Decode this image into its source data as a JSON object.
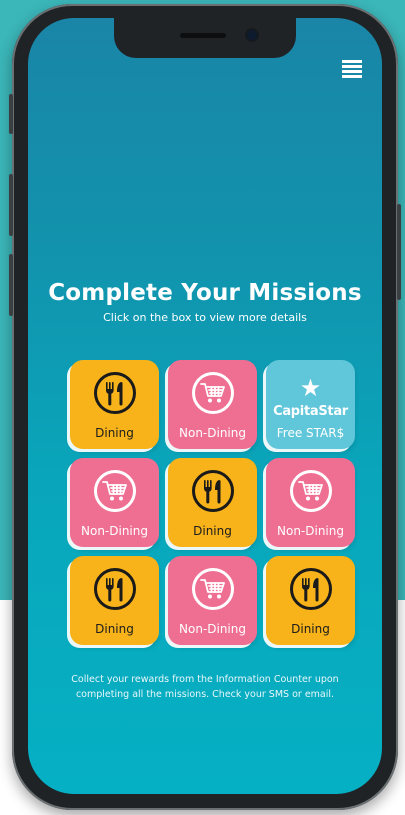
{
  "header": {
    "title": "Complete Your Missions",
    "subtitle": "Click on the box to view more details"
  },
  "menu": {
    "icon": "hamburger-menu-icon"
  },
  "missions": [
    {
      "type": "dining",
      "label": "Dining",
      "icon": "fork-knife-icon"
    },
    {
      "type": "non-dining",
      "label": "Non-Dining",
      "icon": "shopping-cart-icon"
    },
    {
      "type": "capitastar",
      "brand": "CapitaStar",
      "label": "Free STAR$",
      "icon": "star-icon"
    },
    {
      "type": "non-dining",
      "label": "Non-Dining",
      "icon": "shopping-cart-icon"
    },
    {
      "type": "dining",
      "label": "Dining",
      "icon": "fork-knife-icon"
    },
    {
      "type": "non-dining",
      "label": "Non-Dining",
      "icon": "shopping-cart-icon"
    },
    {
      "type": "dining",
      "label": "Dining",
      "icon": "fork-knife-icon"
    },
    {
      "type": "non-dining",
      "label": "Non-Dining",
      "icon": "shopping-cart-icon"
    },
    {
      "type": "dining",
      "label": "Dining",
      "icon": "fork-knife-icon"
    }
  ],
  "footer": {
    "text": "Collect your rewards from the Information Counter upon completing all the missions. Check your SMS or email."
  },
  "colors": {
    "dining": "#f8b31b",
    "non_dining": "#ef6f93",
    "capitastar": "#60c6d9",
    "background_teal": "#3bb6b9"
  }
}
